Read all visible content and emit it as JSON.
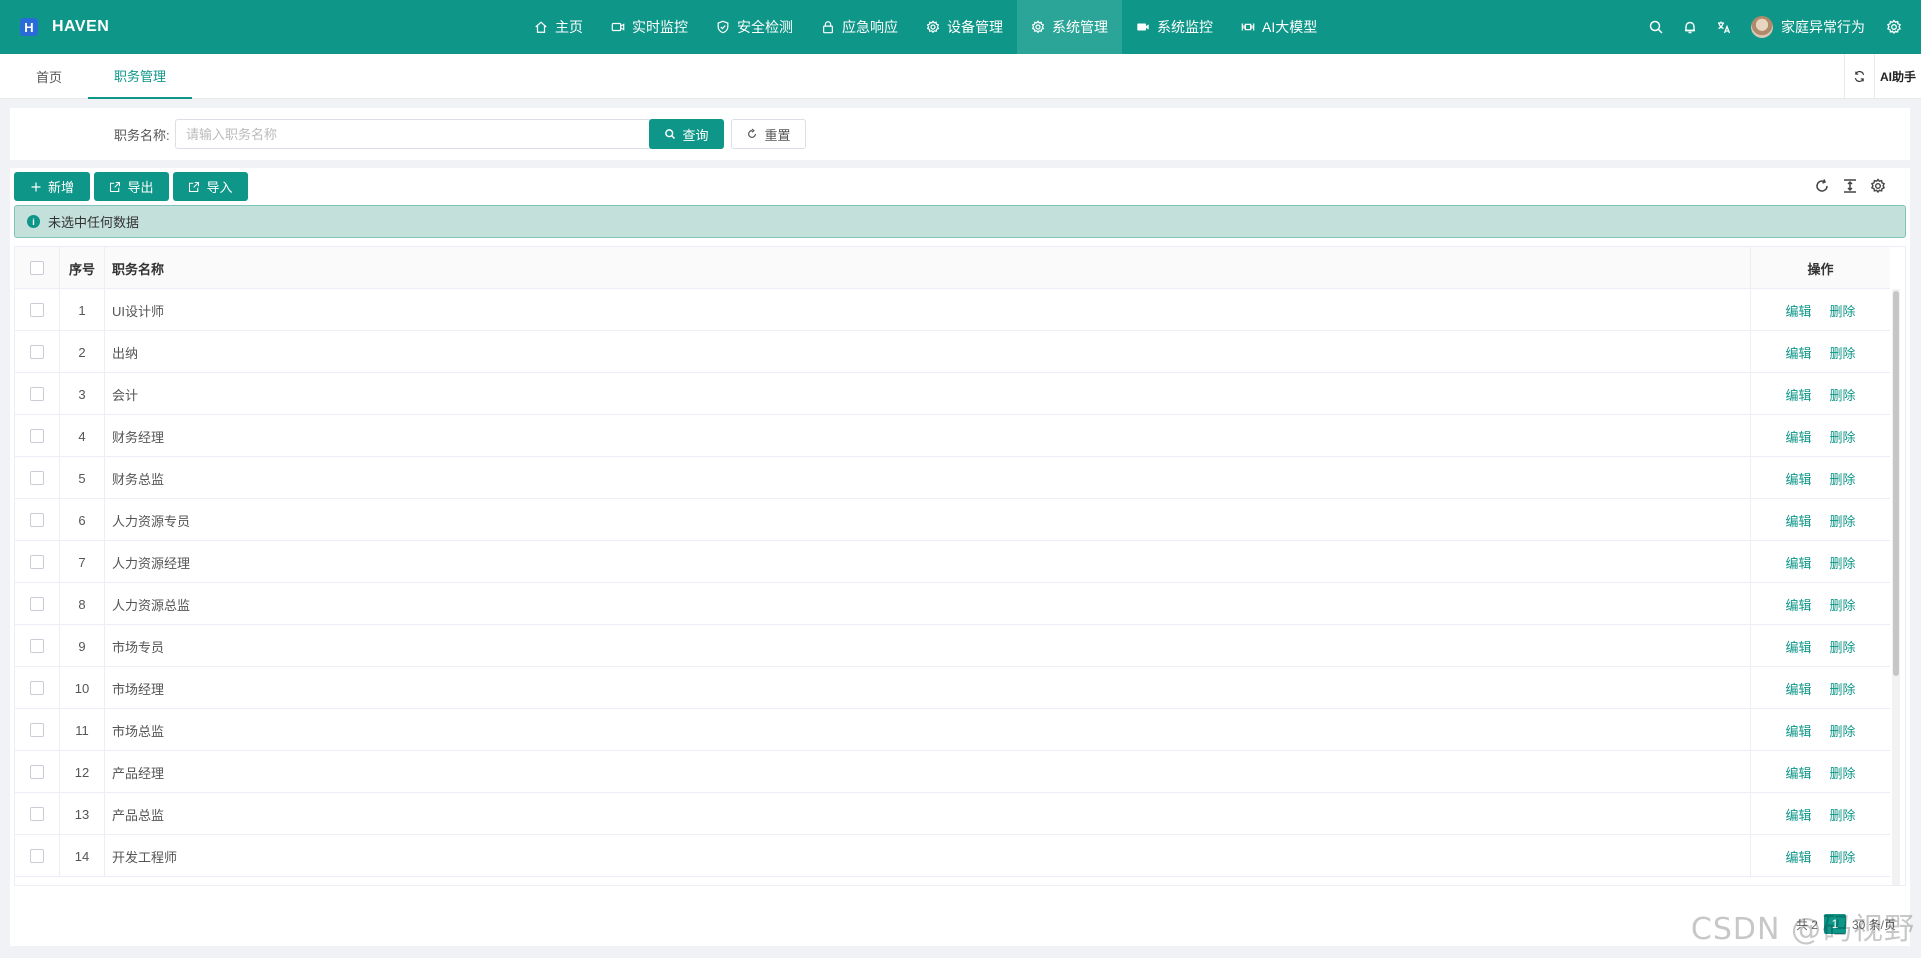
{
  "brand": {
    "logo_letter": "H",
    "name": "HAVEN"
  },
  "nav": {
    "items": [
      {
        "label": "主页",
        "icon": "home-icon"
      },
      {
        "label": "实时监控",
        "icon": "video-icon"
      },
      {
        "label": "安全检测",
        "icon": "shield-icon"
      },
      {
        "label": "应急响应",
        "icon": "lock-icon"
      },
      {
        "label": "设备管理",
        "icon": "gear-icon"
      },
      {
        "label": "系统管理",
        "icon": "gear-icon",
        "active": true
      },
      {
        "label": "系统监控",
        "icon": "camera-icon"
      },
      {
        "label": "AI大模型",
        "icon": "ai-icon"
      }
    ]
  },
  "header_right": {
    "username": "家庭异常行为"
  },
  "tabs": {
    "home": "首页",
    "current": "职务管理",
    "ai_assistant": "AI助手"
  },
  "search": {
    "label": "职务名称:",
    "placeholder": "请输入职务名称",
    "value": "",
    "query_label": "查询",
    "reset_label": "重置"
  },
  "toolbar": {
    "add_label": "新增",
    "export_label": "导出",
    "import_label": "导入"
  },
  "alert": {
    "icon_text": "i",
    "text": "未选中任何数据"
  },
  "table": {
    "columns": {
      "index": "序号",
      "name": "职务名称",
      "ops": "操作"
    },
    "edit_label": "编辑",
    "delete_label": "删除",
    "rows": [
      {
        "idx": "1",
        "name": "UI设计师"
      },
      {
        "idx": "2",
        "name": "出纳"
      },
      {
        "idx": "3",
        "name": "会计"
      },
      {
        "idx": "4",
        "name": "财务经理"
      },
      {
        "idx": "5",
        "name": "财务总监"
      },
      {
        "idx": "6",
        "name": "人力资源专员"
      },
      {
        "idx": "7",
        "name": "人力资源经理"
      },
      {
        "idx": "8",
        "name": "人力资源总监"
      },
      {
        "idx": "9",
        "name": "市场专员"
      },
      {
        "idx": "10",
        "name": "市场经理"
      },
      {
        "idx": "11",
        "name": "市场总监"
      },
      {
        "idx": "12",
        "name": "产品经理"
      },
      {
        "idx": "13",
        "name": "产品总监"
      },
      {
        "idx": "14",
        "name": "开发工程师"
      }
    ]
  },
  "pagination": {
    "total_text": "共 2",
    "current_page": "1",
    "page_size_text": "30 条/页"
  },
  "watermark": "CSDN @码视野",
  "colors": {
    "primary": "#0e9688",
    "active_nav": "#2aa597",
    "alert_bg": "#c3e0da"
  }
}
